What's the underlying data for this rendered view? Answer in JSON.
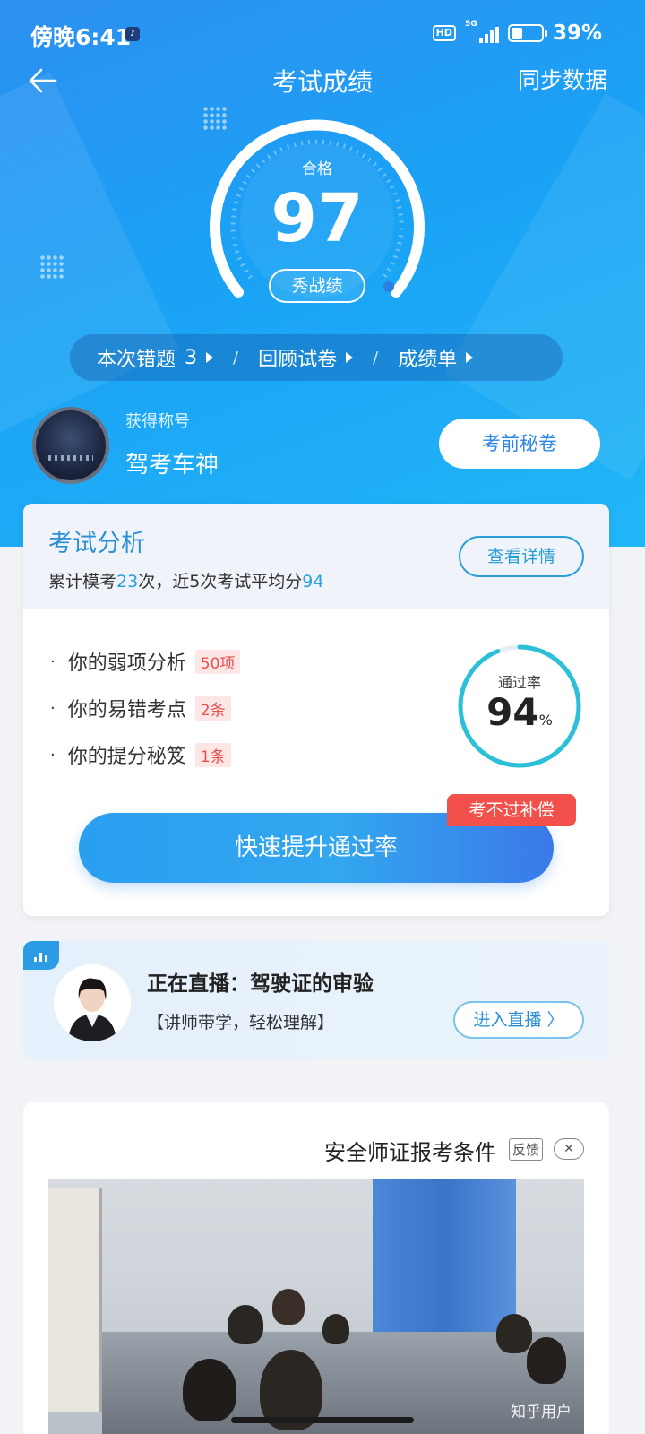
{
  "status_bar": {
    "time": "傍晚6:41",
    "network": "5G",
    "hd": "HD",
    "battery_percent": "39%",
    "battery_level": 0.39
  },
  "header": {
    "title": "考试成绩",
    "sync_label": "同步数据"
  },
  "score": {
    "status": "合格",
    "value": "97",
    "share_label": "秀战绩"
  },
  "summary": {
    "wrong_label": "本次错题",
    "wrong_count": "3",
    "review_label": "回顾试卷",
    "report_label": "成绩单",
    "separator": "/"
  },
  "honor": {
    "label": "获得称号",
    "title": "驾考车神",
    "secret_button": "考前秘卷"
  },
  "analysis": {
    "title": "考试分析",
    "summary_prefix": "累计模考",
    "exam_count": "23",
    "summary_middle": "次，近5次考试平均分",
    "average": "94",
    "detail_button": "查看详情",
    "items": [
      {
        "label": "你的弱项分析",
        "tag": "50项"
      },
      {
        "label": "你的易错考点",
        "tag": "2条"
      },
      {
        "label": "你的提分秘笈",
        "tag": "1条"
      }
    ],
    "pass_rate_label": "通过率",
    "pass_rate_value": "94",
    "pass_rate_unit": "%",
    "pass_rate_fraction": 0.94,
    "boost_button": "快速提升通过率",
    "compensate_badge": "考不过补偿"
  },
  "live": {
    "title": "正在直播：驾驶证的审验",
    "subtitle": "【讲师带学，轻松理解】",
    "enter_button": "进入直播"
  },
  "ad": {
    "title": "安全师证报考条件",
    "feedback": "反馈",
    "close": "✕"
  },
  "watermark": "知乎用户",
  "colors": {
    "primary": "#2a9fd6",
    "accent_red": "#f2504a",
    "hero_blue": "#1aa2f5"
  }
}
